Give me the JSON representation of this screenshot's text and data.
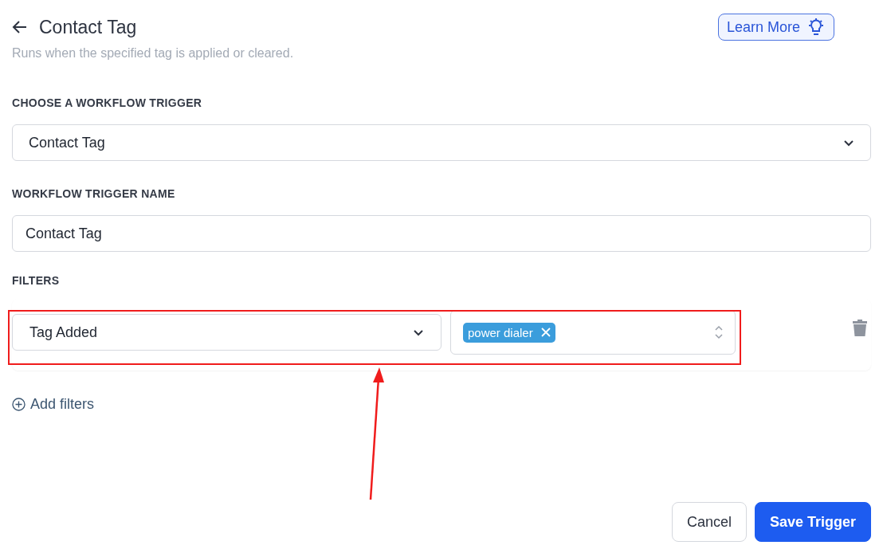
{
  "header": {
    "title": "Contact Tag",
    "subtitle": "Runs when the specified tag is applied or cleared.",
    "learn_more": "Learn More"
  },
  "trigger": {
    "label": "CHOOSE A WORKFLOW TRIGGER",
    "value": "Contact Tag"
  },
  "trigger_name": {
    "label": "WORKFLOW TRIGGER NAME",
    "value": "Contact Tag"
  },
  "filters": {
    "label": "FILTERS",
    "rows": [
      {
        "condition": "Tag Added",
        "tags": [
          "power dialer"
        ]
      }
    ],
    "add": "Add filters"
  },
  "buttons": [
    {
      "label": "Cancel",
      "kind": "secondary"
    },
    {
      "label": "Save Trigger",
      "kind": "primary"
    }
  ]
}
